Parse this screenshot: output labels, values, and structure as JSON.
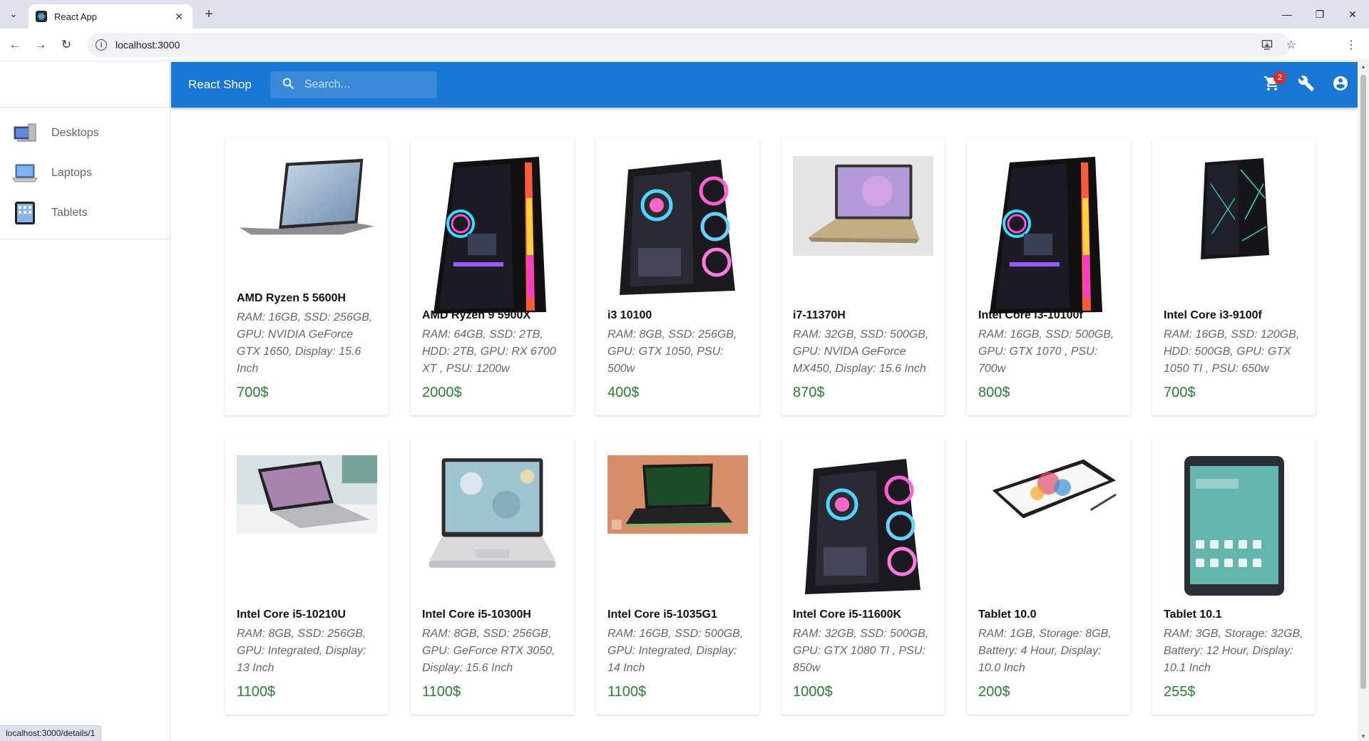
{
  "browser": {
    "tab_title": "React App",
    "url": "localhost:3000",
    "status_url": "localhost:3000/details/1"
  },
  "sidebar": {
    "items": [
      {
        "label": "Desktops",
        "icon": "desktop-icon"
      },
      {
        "label": "Laptops",
        "icon": "laptop-icon"
      },
      {
        "label": "Tablets",
        "icon": "tablet-icon"
      }
    ]
  },
  "header": {
    "brand": "React Shop",
    "search_placeholder": "Search...",
    "cart_count": "2",
    "accent_color": "#1976d2"
  },
  "products": [
    {
      "name": "AMD Ryzen 5 5600H",
      "specs": "RAM: 16GB, SSD: 256GB, GPU: NVIDIA GeForce GTX 1650, Display: 15.6 Inch",
      "price": "700$",
      "kind": "laptop-gray"
    },
    {
      "name": "AMD Ryzen 9 5900X",
      "specs": "RAM: 64GB, SSD: 2TB, HDD: 2TB, GPU: RX 6700 XT , PSU: 1200w",
      "price": "2000$",
      "kind": "tower-rgb"
    },
    {
      "name": "i3 10100",
      "specs": "RAM: 8GB, SSD: 256GB, GPU: GTX 1050, PSU: 500w",
      "price": "400$",
      "kind": "tower-fans"
    },
    {
      "name": "i7-11370H",
      "specs": "RAM: 32GB, SSD: 500GB, GPU: NVIDA GeForce MX450, Display: 15.6 Inch",
      "price": "870$",
      "kind": "laptop-gold"
    },
    {
      "name": "Intel Core i3-10100f",
      "specs": "RAM: 16GB, SSD: 500GB, GPU: GTX 1070 , PSU: 700w",
      "price": "800$",
      "kind": "tower-rgb"
    },
    {
      "name": "Intel Core i3-9100f",
      "specs": "RAM: 16GB, SSD: 120GB, HDD: 500GB, GPU: GTX 1050 TI , PSU: 650w",
      "price": "700$",
      "kind": "tower-small"
    },
    {
      "name": "Intel Core i5-10210U",
      "specs": "RAM: 8GB, SSD: 256GB, GPU: Integrated, Display: 13 Inch",
      "price": "1100$",
      "kind": "laptop-desk"
    },
    {
      "name": "Intel Core i5-10300H",
      "specs": "RAM: 8GB, SSD: 256GB, GPU: GeForce RTX 3050, Display: 15.6 Inch",
      "price": "1100$",
      "kind": "laptop-silver"
    },
    {
      "name": "Intel Core i5-1035G1",
      "specs": "RAM: 16GB, SSD: 500GB, GPU: Integrated, Display: 14 Inch",
      "price": "1100$",
      "kind": "laptop-orange"
    },
    {
      "name": "Intel Core i5-11600K",
      "specs": "RAM: 32GB, SSD: 500GB, GPU: GTX 1080 TI , PSU: 850w",
      "price": "1000$",
      "kind": "tower-fans"
    },
    {
      "name": "Tablet 10.0",
      "specs": "RAM: 1GB, Storage: 8GB, Battery: 4 Hour, Display: 10.0 Inch",
      "price": "200$",
      "kind": "pen-tablet"
    },
    {
      "name": "Tablet 10.1",
      "specs": "RAM: 3GB, Storage: 32GB, Battery: 12 Hour, Display: 10.1 Inch",
      "price": "255$",
      "kind": "tablet"
    }
  ]
}
